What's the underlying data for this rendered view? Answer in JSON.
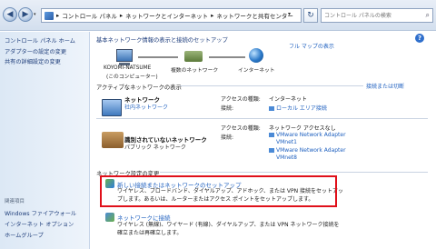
{
  "addressbar": {
    "breadcrumbs": [
      "コントロール パネル",
      "ネットワークとインターネット",
      "ネットワークと共有センター"
    ],
    "search_placeholder": "コントロール パネルの検索"
  },
  "sidebar": {
    "home": "コントロール パネル ホーム",
    "items": [
      "アダプターの設定の変更",
      "共有の詳細設定の変更"
    ],
    "related_label": "関連項目",
    "related": [
      "Windows ファイアウォール",
      "インターネット オプション",
      "ホームグループ"
    ]
  },
  "main": {
    "title": "基本ネットワーク情報の表示と接続のセットアップ",
    "full_map": "フル マップの表示",
    "map": {
      "computer": "KOYOMI-NATSUME",
      "computer_sub": "(このコンピューター)",
      "multi": "複数のネットワーク",
      "internet": "インターネット"
    },
    "active_header": "アクティブなネットワークの表示",
    "connect_disconnect": "接続または切断",
    "networks": [
      {
        "name": "ネットワーク",
        "type": "社内ネットワーク",
        "access_label": "アクセスの種類:",
        "access": "インターネット",
        "conn_label": "接続:",
        "connections": [
          "ローカル エリア接続"
        ]
      },
      {
        "name": "識別されていないネットワーク",
        "type": "パブリック ネットワーク",
        "access_label": "アクセスの種類:",
        "access": "ネットワーク アクセスなし",
        "conn_label": "接続:",
        "connections": [
          "VMware Network Adapter",
          "VMnet1",
          "VMware Network Adapter",
          "VMnet8"
        ]
      }
    ],
    "settings_header": "ネットワーク設定の変更",
    "tasks": [
      {
        "title": "新しい接続またはネットワークのセットアップ",
        "desc": "ワイヤレス、ブロードバンド、ダイヤルアップ、アドホック、または VPN 接続をセットアップします。あるいは、ルーターまたはアクセス ポイントをセットアップします。"
      },
      {
        "title": "ネットワークに接続",
        "desc": "ワイヤレス (無線)、ワイヤード (有線)、ダイヤルアップ、または VPN ネットワーク接続を確立または再確立します。"
      }
    ]
  },
  "colors": {
    "highlight": "#e0101a",
    "link": "#1d5fbf"
  }
}
